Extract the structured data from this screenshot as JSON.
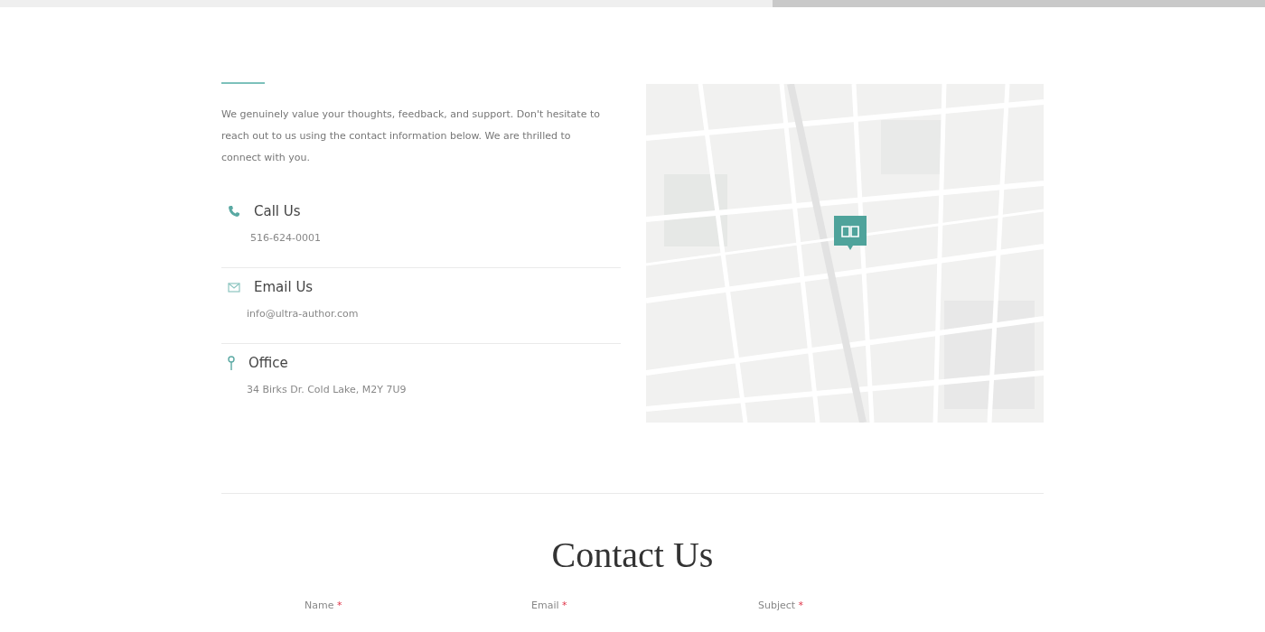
{
  "intro": "We genuinely value your thoughts, feedback, and support. Don't hesitate to reach out to us using the contact information below. We are thrilled to connect with you.",
  "contacts": [
    {
      "kind": "phone",
      "title": "Call Us",
      "detail": "516-624-0001"
    },
    {
      "kind": "email",
      "title": "Email Us",
      "detail": "info@ultra-author.com"
    },
    {
      "kind": "office",
      "title": "Office",
      "detail": "34 Birks Dr. Cold Lake, M2Y 7U9"
    }
  ],
  "form": {
    "title": "Contact Us",
    "fields": [
      {
        "label": "Name",
        "required": true,
        "mark": "*"
      },
      {
        "label": "Email",
        "required": true,
        "mark": "*"
      },
      {
        "label": "Subject",
        "required": true,
        "mark": "*"
      }
    ]
  }
}
